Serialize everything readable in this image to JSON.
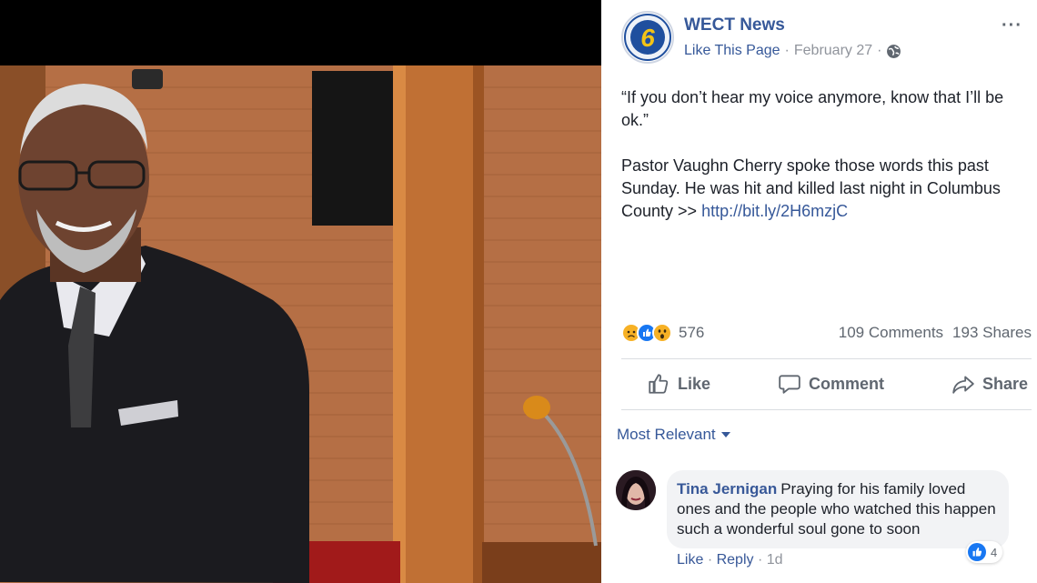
{
  "post": {
    "page_name": "WECT News",
    "like_page": "Like This Page",
    "separator": "·",
    "date": "February 27",
    "more": "···",
    "quote": "“If you don’t hear my voice anymore, know that I’ll be ok.”",
    "body": "Pastor Vaughn Cherry spoke those words this past Sunday. He was hit and killed last night in Columbus County >> ",
    "link": "http://bit.ly/2H6mzjC",
    "logo_text": "6"
  },
  "stats": {
    "reaction_count": "576",
    "comments": "109 Comments",
    "shares": "193 Shares"
  },
  "actions": {
    "like": "Like",
    "comment": "Comment",
    "share": "Share"
  },
  "comments": {
    "sort_label": "Most Relevant",
    "items": [
      {
        "author": "Tina Jernigan",
        "text": "Praying for his family loved ones and the people who watched this happen such a wonderful soul gone to soon",
        "reaction_count": "4",
        "like": "Like",
        "reply": "Reply",
        "age": "1d"
      }
    ]
  },
  "colors": {
    "link": "#365899",
    "meta": "#90949c",
    "like_blue": "#1877f2",
    "sad_yellow": "#f7b125"
  },
  "icons": [
    "globe-icon",
    "sad-reaction-icon",
    "like-reaction-icon",
    "wow-reaction-icon",
    "thumbs-up-icon",
    "comment-icon",
    "share-icon",
    "chevron-down-icon",
    "more-icon"
  ]
}
